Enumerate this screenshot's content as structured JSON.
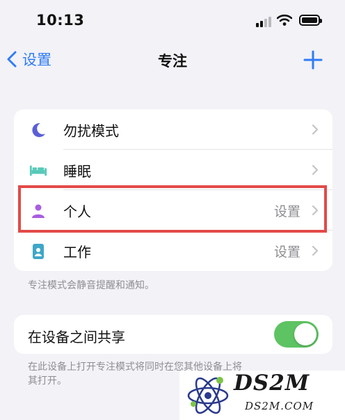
{
  "status": {
    "time": "10:13"
  },
  "nav": {
    "back_label": "设置",
    "title": "专注"
  },
  "focus_list": [
    {
      "label": "勿扰模式",
      "value": "",
      "icon": "moon-icon",
      "color": "#5b5fd6"
    },
    {
      "label": "睡眠",
      "value": "",
      "icon": "bed-icon",
      "color": "#57c9b9"
    },
    {
      "label": "个人",
      "value": "设置",
      "icon": "person-icon",
      "color": "#a85ee0"
    },
    {
      "label": "工作",
      "value": "设置",
      "icon": "id-badge-icon",
      "color": "#3fa7c7"
    }
  ],
  "focus_footnote": "专注模式会静音提醒和通知。",
  "share": {
    "label": "在设备之间共享",
    "enabled": true,
    "footnote_line1": "在此设备上打开专注模式将同时在您其他设备上将",
    "footnote_line2": "其打开。"
  },
  "watermark": {
    "main": "DS2M",
    "sub": "DS2M.COM"
  },
  "colors": {
    "accent": "#2f7cf6",
    "toggle_on": "#5ec363",
    "highlight": "#e34a48"
  }
}
